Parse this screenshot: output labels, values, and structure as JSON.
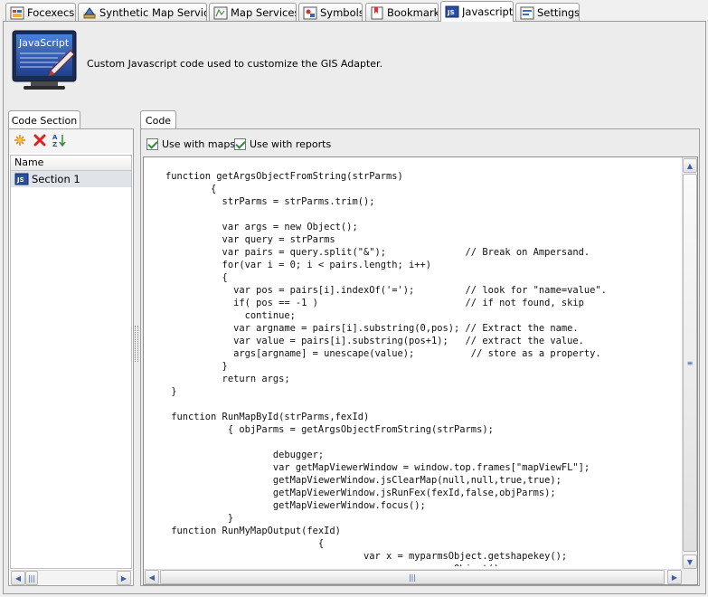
{
  "tabs": [
    {
      "label": "Focexecs",
      "icon": "focexec-icon"
    },
    {
      "label": "Synthetic Map Services",
      "icon": "synthetic-map-icon"
    },
    {
      "label": "Map Services",
      "icon": "map-services-icon"
    },
    {
      "label": "Symbols",
      "icon": "symbols-icon"
    },
    {
      "label": "Bookmarks",
      "icon": "bookmarks-icon"
    },
    {
      "label": "Javascript",
      "icon": "javascript-icon",
      "active": true
    },
    {
      "label": "Settings",
      "icon": "settings-icon"
    }
  ],
  "header": {
    "logo_text": "JavaScript",
    "description": "Custom Javascript code used to customize the GIS Adapter."
  },
  "code_section": {
    "tab_label": "Code Section",
    "toolbar": {
      "new_icon": "new-icon",
      "delete_icon": "delete-icon",
      "sort_icon": "sort-az-icon"
    },
    "column_header": "Name",
    "items": [
      {
        "label": "Section 1",
        "selected": true
      }
    ]
  },
  "code_panel": {
    "tab_label": "Code",
    "use_with_maps_label": "Use with maps",
    "use_with_maps_checked": true,
    "use_with_reports_label": "Use with reports",
    "use_with_reports_checked": true,
    "code": "function getArgsObjectFromString(strParms)\n        {\n          strParms = strParms.trim();\n\n          var args = new Object();\n          var query = strParms\n          var pairs = query.split(\"&\");              // Break on Ampersand.\n          for(var i = 0; i < pairs.length; i++)\n          {\n            var pos = pairs[i].indexOf('=');         // look for \"name=value\".\n            if( pos == -1 )                          // if not found, skip\n              continue;\n            var argname = pairs[i].substring(0,pos); // Extract the name.\n            var value = pairs[i].substring(pos+1);   // extract the value.\n            args[argname] = unescape(value);          // store as a property.\n          }\n          return args;\n }\n\n function RunMapById(strParms,fexId)\n           { objParms = getArgsObjectFromString(strParms);\n\n                   debugger;\n                   var getMapViewerWindow = window.top.frames[\"mapViewFL\"];\n                   getMapViewerWindow.jsClearMap(null,null,true,true);\n                   getMapViewerWindow.jsRunFex(fexId,false,objParms);\n                   getMapViewerWindow.focus();\n           }\n function RunMyMapOutput(fexId)\n                           {\n                                   var x = myparmsObject.getshapekey();\n                                   var parms = new Object();"
  }
}
